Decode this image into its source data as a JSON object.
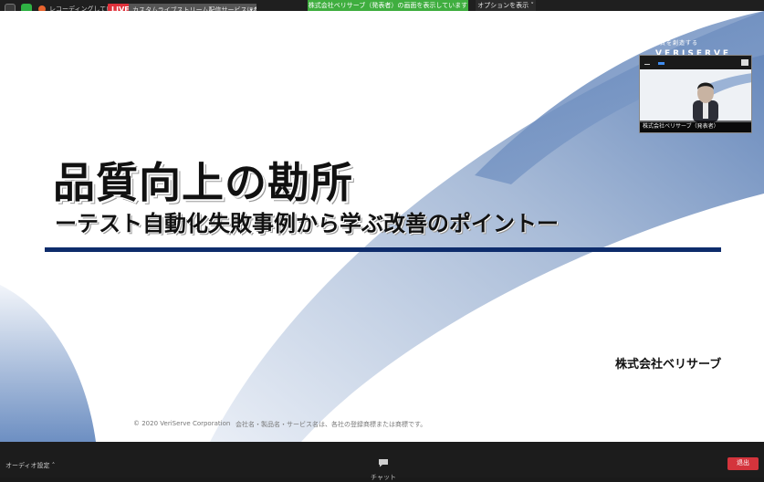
{
  "topbar": {
    "recording_text": "レコーディングしています",
    "live_label": "LIVE",
    "stream_text": "カスタムライブストリーム配信サービスに参加中",
    "viewing_banner": "株式会社ベリサーブ（発表者）の画面を表示しています",
    "options_label": "オプションを表示"
  },
  "slide": {
    "tagline": "品質を創造する",
    "brand": "VERISERVE",
    "title": "品質向上の勘所",
    "subtitle": "ーテスト自動化失敗事例から学ぶ改善のポイントー",
    "company": "株式会社ベリサーブ",
    "copyright": "© 2020 VeriServe Corporation",
    "trademark_note": "会社名・製品名・サービス名は、各社の登録商標または商標です。"
  },
  "video_thumbnail": {
    "name": "株式会社ベリサーブ（発表者）"
  },
  "bottombar": {
    "audio_label": "オーディオ設定",
    "chat_label": "チャット",
    "leave_label": "退出"
  },
  "colors": {
    "live_red": "#e0323c",
    "banner_green": "#3fae3f",
    "slide_navy": "#0e2c6b",
    "leave_red": "#d4343c"
  }
}
